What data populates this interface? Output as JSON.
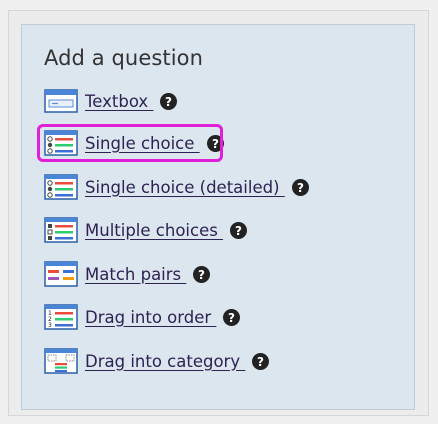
{
  "heading": "Add a question",
  "items": [
    {
      "label": "Textbox ",
      "icon": "textbox-icon"
    },
    {
      "label": "Single choice ",
      "icon": "single-choice-icon"
    },
    {
      "label": "Single choice (detailed) ",
      "icon": "single-choice-detailed-icon"
    },
    {
      "label": "Multiple choices ",
      "icon": "multiple-choices-icon"
    },
    {
      "label": "Match pairs ",
      "icon": "match-pairs-icon"
    },
    {
      "label": "Drag into order ",
      "icon": "drag-into-order-icon"
    },
    {
      "label": "Drag into category ",
      "icon": "drag-into-category-icon"
    }
  ],
  "highlighted_item": "Single choice",
  "colors": {
    "panel": "#dce6ef",
    "highlight": "#e020d8",
    "link": "#2e2252"
  }
}
